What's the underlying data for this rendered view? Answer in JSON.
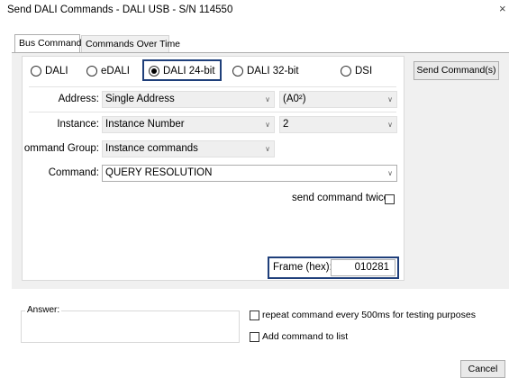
{
  "window": {
    "title": "Send DALI Commands - DALI USB - S/N 114550",
    "close_glyph": "×"
  },
  "tabs": [
    {
      "label": "Bus Commands",
      "active": true
    },
    {
      "label": "Commands Over Time",
      "active": false
    }
  ],
  "protocols": {
    "options": [
      {
        "label": "DALI",
        "checked": false
      },
      {
        "label": "eDALI",
        "checked": false
      },
      {
        "label": "DALI 24-bit",
        "checked": true
      },
      {
        "label": "DALI 32-bit",
        "checked": false
      },
      {
        "label": "DSI",
        "checked": false
      }
    ]
  },
  "send_button": "Send Command(s)",
  "form": {
    "address": {
      "label": "Address:",
      "value": "Single Address",
      "sub_value": "(A0²)"
    },
    "instance": {
      "label": "Instance:",
      "value": "Instance Number",
      "sub_value": "2"
    },
    "command_group": {
      "label": "ommand Group:",
      "value": "Instance commands"
    },
    "command": {
      "label": "Command:",
      "value": "QUERY RESOLUTION"
    },
    "send_twice": {
      "label": "send command twice",
      "checked": false
    },
    "frame": {
      "label": "Frame (hex):",
      "value": "010281"
    }
  },
  "answer": {
    "label": "Answer:",
    "value": ""
  },
  "options": {
    "repeat": {
      "label": "repeat command every 500ms for testing purposes",
      "checked": false
    },
    "add_to_list": {
      "label": "Add command to list",
      "checked": false
    }
  },
  "cancel_button": "Cancel",
  "colors": {
    "highlight": "#1f3f7a",
    "panel": "#f0f0f0"
  }
}
